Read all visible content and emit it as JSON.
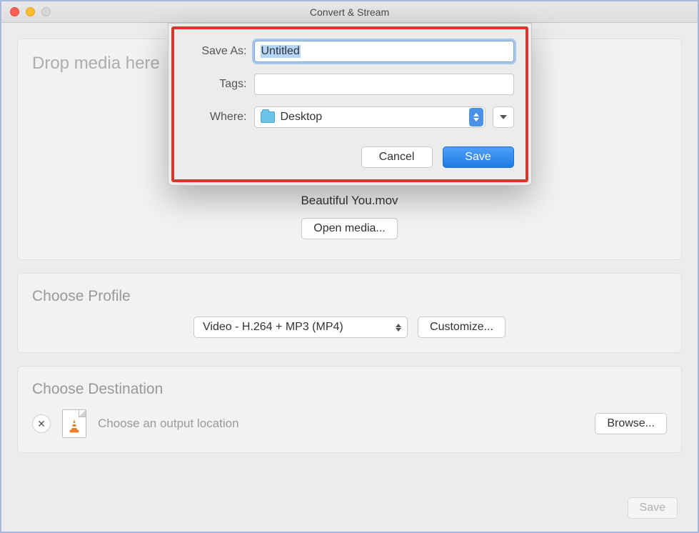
{
  "window": {
    "title": "Convert & Stream"
  },
  "dropPanel": {
    "dropText": "Drop media here",
    "filename": "Beautiful You.mov",
    "openMediaLabel": "Open media..."
  },
  "profilePanel": {
    "title": "Choose Profile",
    "selectedProfile": "Video - H.264 + MP3 (MP4)",
    "customizeLabel": "Customize..."
  },
  "destinationPanel": {
    "title": "Choose Destination",
    "placeholderText": "Choose an output location",
    "browseLabel": "Browse..."
  },
  "footer": {
    "saveLabel": "Save"
  },
  "saveSheet": {
    "saveAsLabel": "Save As:",
    "saveAsValue": "Untitled",
    "tagsLabel": "Tags:",
    "tagsValue": "",
    "whereLabel": "Where:",
    "whereValue": "Desktop",
    "cancelLabel": "Cancel",
    "saveLabel": "Save"
  }
}
